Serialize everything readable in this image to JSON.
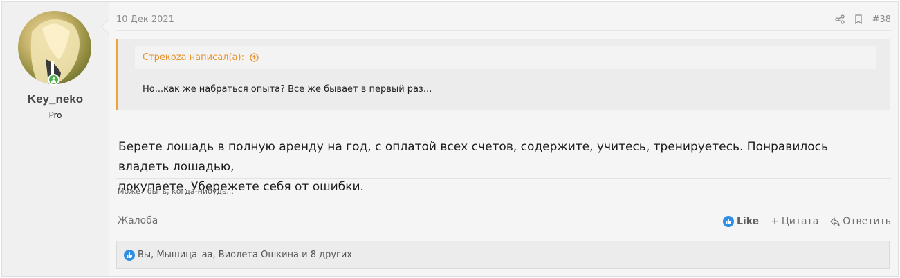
{
  "user": {
    "name": "Key_neko",
    "title": "Pro"
  },
  "post": {
    "date": "10 Дек 2021",
    "number": "#38",
    "quote": {
      "author_line": "Стрекоza написал(а):",
      "text": "Но...как же набраться опыта? Все же бывает в первый раз..."
    },
    "message_line1": "Берете лошадь в полную аренду на год, с оплатой всех счетов, содержите, учитесь, тренируетесь. Понравилось владеть лошадью,",
    "message_line2": "покупаете. Убережете себя от ошибки.",
    "signature": "Может быть, когда-нибудь..."
  },
  "actions": {
    "report": "Жалоба",
    "like": "Like",
    "quote": "Цитата",
    "reply": "Ответить"
  },
  "reactions": {
    "text": "Вы, Мышица_аа, Виолета Ошкина и 8 других"
  },
  "colors": {
    "accent": "#f0a33a",
    "like_blue": "#2d8fe3",
    "online_green": "#4fb04a"
  }
}
